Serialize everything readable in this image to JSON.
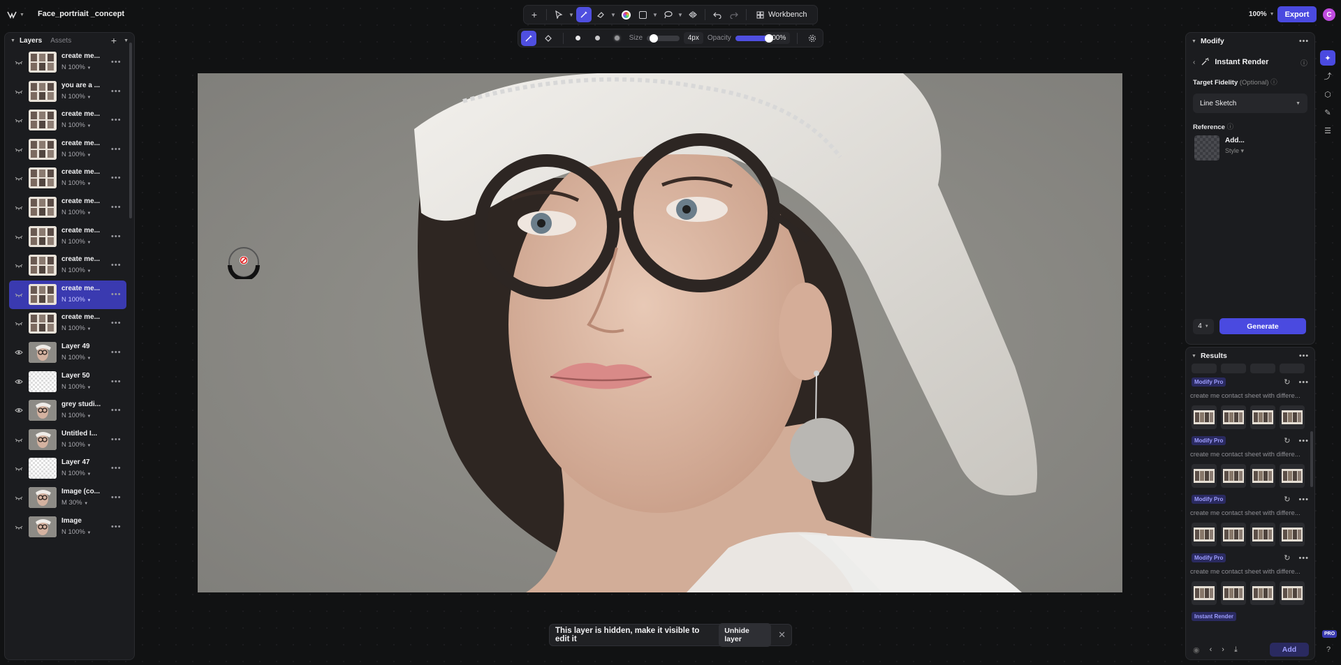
{
  "app": {
    "project_title": "Face_portriait _concept",
    "zoom": "100%",
    "export_label": "Export",
    "avatar_initial": "C",
    "workbench_label": "Workbench",
    "pro_badge": "PRO"
  },
  "brush": {
    "size_label": "Size",
    "size_value": "4px",
    "opacity_label": "Opacity",
    "opacity_value": "100%",
    "opacity_fraction": 1.0,
    "size_fraction": 0.05
  },
  "layers_panel": {
    "tab_layers": "Layers",
    "tab_assets": "Assets",
    "items": [
      {
        "name": "create me...",
        "meta": "N 100%",
        "visible": false,
        "thumb": "sheet"
      },
      {
        "name": "you are a ...",
        "meta": "N 100%",
        "visible": false,
        "thumb": "sheet"
      },
      {
        "name": "create me...",
        "meta": "N 100%",
        "visible": false,
        "thumb": "sheet"
      },
      {
        "name": "create me...",
        "meta": "N 100%",
        "visible": false,
        "thumb": "sheet"
      },
      {
        "name": "create me...",
        "meta": "N 100%",
        "visible": false,
        "thumb": "sheet"
      },
      {
        "name": "create me...",
        "meta": "N 100%",
        "visible": false,
        "thumb": "sheet"
      },
      {
        "name": "create me...",
        "meta": "N 100%",
        "visible": false,
        "thumb": "sheet"
      },
      {
        "name": "create me...",
        "meta": "N 100%",
        "visible": false,
        "thumb": "sheet"
      },
      {
        "name": "create me...",
        "meta": "N 100%",
        "visible": false,
        "thumb": "sheet",
        "selected": true
      },
      {
        "name": "create me...",
        "meta": "N 100%",
        "visible": false,
        "thumb": "sheet"
      },
      {
        "name": "Layer 49",
        "meta": "N 100%",
        "visible": true,
        "thumb": "portrait"
      },
      {
        "name": "Layer 50",
        "meta": "N 100%",
        "visible": true,
        "thumb": "empty"
      },
      {
        "name": "grey studi...",
        "meta": "N 100%",
        "visible": true,
        "thumb": "portrait"
      },
      {
        "name": "Untitled I...",
        "meta": "N 100%",
        "visible": false,
        "thumb": "portrait"
      },
      {
        "name": "Layer 47",
        "meta": "N 100%",
        "visible": false,
        "thumb": "empty"
      },
      {
        "name": "Image (co...",
        "meta": "M 30%",
        "visible": false,
        "thumb": "portrait"
      },
      {
        "name": "Image",
        "meta": "N 100%",
        "visible": false,
        "thumb": "portrait"
      }
    ]
  },
  "toast": {
    "message": "This layer is hidden, make it visible to edit it",
    "action": "Unhide layer"
  },
  "modify_panel": {
    "title": "Modify",
    "tool_title": "Instant Render",
    "fidelity_label": "Target Fidelity",
    "fidelity_optional": "(Optional)",
    "fidelity_value": "Line Sketch",
    "reference_label": "Reference",
    "reference_add": "Add...",
    "reference_style": "Style",
    "count_value": "4",
    "generate_label": "Generate"
  },
  "results_panel": {
    "title": "Results",
    "groups": [
      {
        "badge": "Modify Pro",
        "prompt": "create me contact sheet with differe..."
      },
      {
        "badge": "Modify Pro",
        "prompt": "create me contact sheet with differe..."
      },
      {
        "badge": "Modify Pro",
        "prompt": "create me contact sheet with differe..."
      },
      {
        "badge": "Modify Pro",
        "prompt": "create me contact sheet with differe..."
      }
    ],
    "next_badge": "Instant Render",
    "add_label": "Add"
  },
  "colors": {
    "accent": "#4a4ae0",
    "background": "#111213",
    "panel": "#1b1c1f"
  }
}
